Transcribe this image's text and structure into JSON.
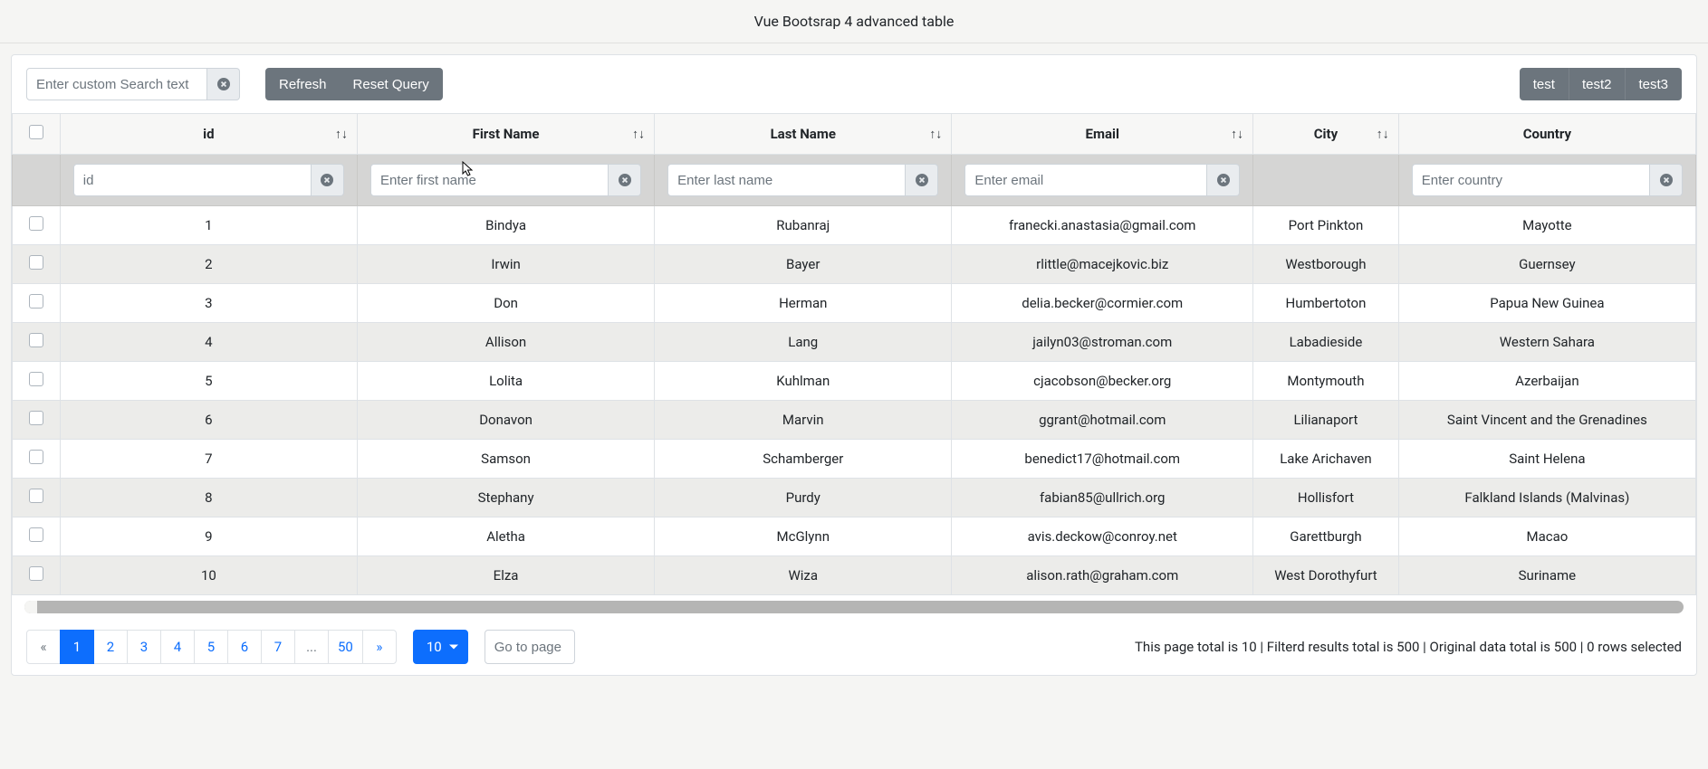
{
  "header": {
    "title": "Vue Bootsrap 4 advanced table"
  },
  "toolbar": {
    "search_placeholder": "Enter custom Search text",
    "refresh": "Refresh",
    "reset": "Reset Query",
    "right": [
      "test",
      "test2",
      "test3"
    ]
  },
  "columns": [
    {
      "key": "id",
      "label": "id",
      "sortable": true,
      "filter_placeholder": "id",
      "filter_value": ""
    },
    {
      "key": "first",
      "label": "First Name",
      "sortable": true,
      "filter_placeholder": "Enter first name",
      "filter_value": ""
    },
    {
      "key": "last",
      "label": "Last Name",
      "sortable": true,
      "filter_placeholder": "Enter last name",
      "filter_value": ""
    },
    {
      "key": "email",
      "label": "Email",
      "sortable": true,
      "filter_placeholder": "Enter email",
      "filter_value": ""
    },
    {
      "key": "city",
      "label": "City",
      "sortable": true
    },
    {
      "key": "country",
      "label": "Country",
      "sortable": false,
      "filter_placeholder": "Enter country",
      "filter_value": ""
    }
  ],
  "rows": [
    {
      "id": "1",
      "first": "Bindya",
      "last": "Rubanraj",
      "email": "franecki.anastasia@gmail.com",
      "city": "Port Pinkton",
      "country": "Mayotte"
    },
    {
      "id": "2",
      "first": "Irwin",
      "last": "Bayer",
      "email": "rlittle@macejkovic.biz",
      "city": "Westborough",
      "country": "Guernsey"
    },
    {
      "id": "3",
      "first": "Don",
      "last": "Herman",
      "email": "delia.becker@cormier.com",
      "city": "Humbertoton",
      "country": "Papua New Guinea"
    },
    {
      "id": "4",
      "first": "Allison",
      "last": "Lang",
      "email": "jailyn03@stroman.com",
      "city": "Labadieside",
      "country": "Western Sahara"
    },
    {
      "id": "5",
      "first": "Lolita",
      "last": "Kuhlman",
      "email": "cjacobson@becker.org",
      "city": "Montymouth",
      "country": "Azerbaijan"
    },
    {
      "id": "6",
      "first": "Donavon",
      "last": "Marvin",
      "email": "ggrant@hotmail.com",
      "city": "Lilianaport",
      "country": "Saint Vincent and the Grenadines"
    },
    {
      "id": "7",
      "first": "Samson",
      "last": "Schamberger",
      "email": "benedict17@hotmail.com",
      "city": "Lake Arichaven",
      "country": "Saint Helena"
    },
    {
      "id": "8",
      "first": "Stephany",
      "last": "Purdy",
      "email": "fabian85@ullrich.org",
      "city": "Hollisfort",
      "country": "Falkland Islands (Malvinas)"
    },
    {
      "id": "9",
      "first": "Aletha",
      "last": "McGlynn",
      "email": "avis.deckow@conroy.net",
      "city": "Garettburgh",
      "country": "Macao"
    },
    {
      "id": "10",
      "first": "Elza",
      "last": "Wiza",
      "email": "alison.rath@graham.com",
      "city": "West Dorothyfurt",
      "country": "Suriname"
    }
  ],
  "pagination": {
    "prev": "«",
    "next": "»",
    "pages": [
      "1",
      "2",
      "3",
      "4",
      "5",
      "6",
      "7",
      "...",
      "50"
    ],
    "active_index": 0,
    "page_size": "10",
    "goto_placeholder": "Go to page"
  },
  "stats": {
    "text": "This page total is 10 | Filterd results total is 500 | Original data total is 500 | 0 rows selected"
  }
}
